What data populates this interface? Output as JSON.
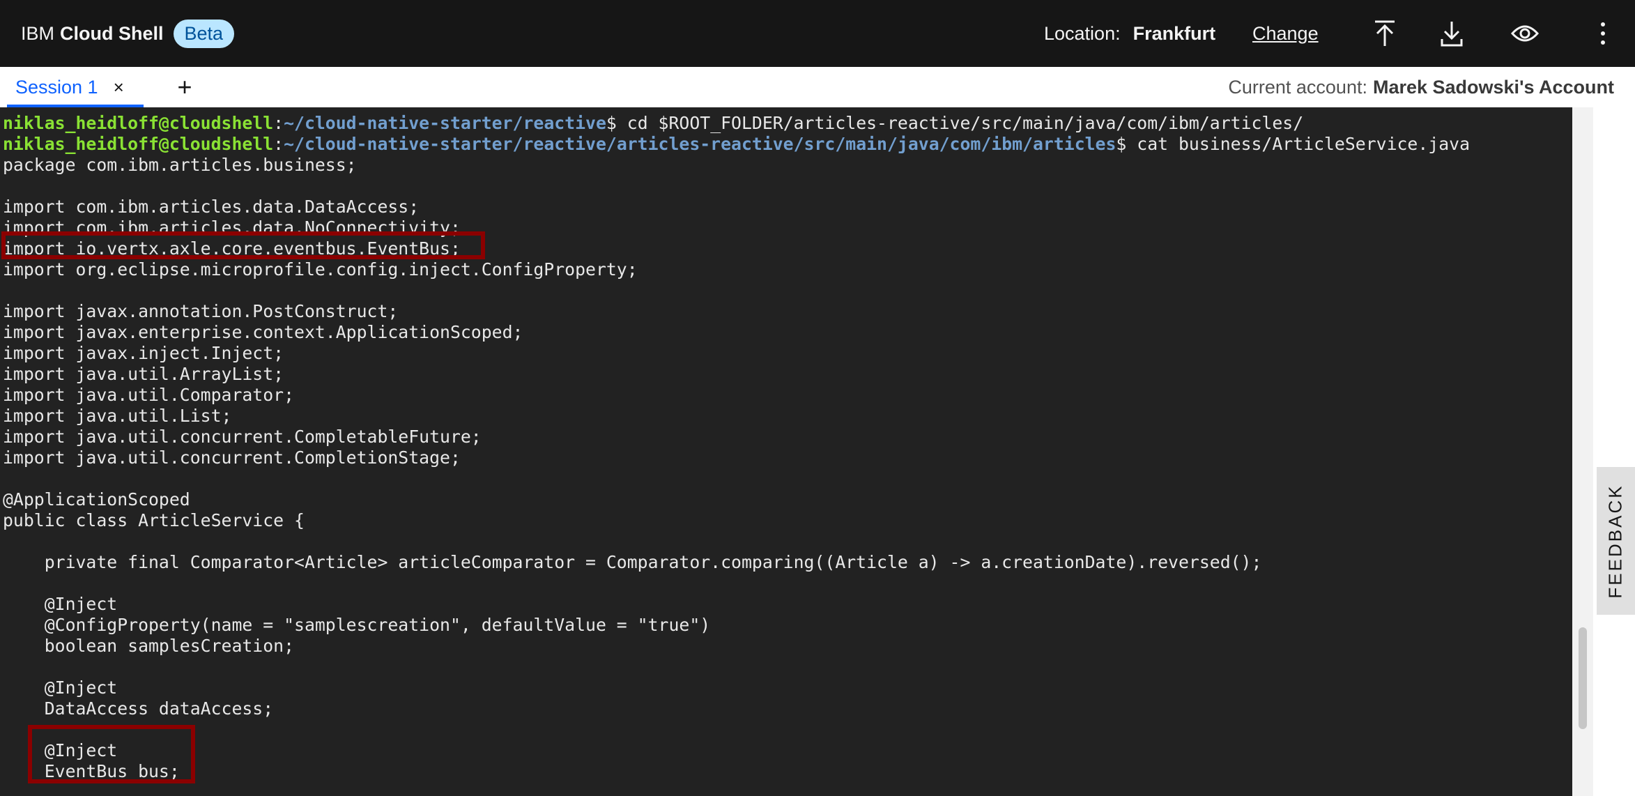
{
  "header": {
    "brand_ibm": "IBM",
    "brand_product": "Cloud Shell",
    "badge": "Beta",
    "location_label": "Location:",
    "location_value": "Frankfurt",
    "change_link": "Change"
  },
  "icons": {
    "upload": "upload-icon",
    "download": "download-icon",
    "preview": "eye-icon",
    "menu": "overflow-menu-icon",
    "close": "close-icon",
    "add": "add-icon"
  },
  "tabs": [
    {
      "label": "Session 1",
      "close": "×"
    }
  ],
  "add_tab": "+",
  "account": {
    "label": "Current account:",
    "name": "Marek Sadowski's Account"
  },
  "terminal": {
    "prompt1": {
      "user": "niklas_heidloff@cloudshell",
      "sep": ":",
      "path": "~/cloud-native-starter/reactive",
      "cmd": "$ cd $ROOT_FOLDER/articles-reactive/src/main/java/com/ibm/articles/"
    },
    "prompt2": {
      "user": "niklas_heidloff@cloudshell",
      "sep": ":",
      "path": "~/cloud-native-starter/reactive/articles-reactive/src/main/java/com/ibm/articles",
      "cmd": "$ cat business/ArticleService.java"
    },
    "lines": [
      "package com.ibm.articles.business;",
      "",
      "import com.ibm.articles.data.DataAccess;",
      "import com.ibm.articles.data.NoConnectivity;",
      "import io.vertx.axle.core.eventbus.EventBus;",
      "import org.eclipse.microprofile.config.inject.ConfigProperty;",
      "",
      "import javax.annotation.PostConstruct;",
      "import javax.enterprise.context.ApplicationScoped;",
      "import javax.inject.Inject;",
      "import java.util.ArrayList;",
      "import java.util.Comparator;",
      "import java.util.List;",
      "import java.util.concurrent.CompletableFuture;",
      "import java.util.concurrent.CompletionStage;",
      "",
      "@ApplicationScoped",
      "public class ArticleService {",
      "",
      "    private final Comparator<Article> articleComparator = Comparator.comparing((Article a) -> a.creationDate).reversed();",
      "",
      "    @Inject",
      "    @ConfigProperty(name = \"samplescreation\", defaultValue = \"true\")",
      "    boolean samplesCreation;",
      "",
      "    @Inject",
      "    DataAccess dataAccess;",
      "",
      "    @Inject",
      "    EventBus bus;"
    ]
  },
  "feedback": "FEEDBACK"
}
